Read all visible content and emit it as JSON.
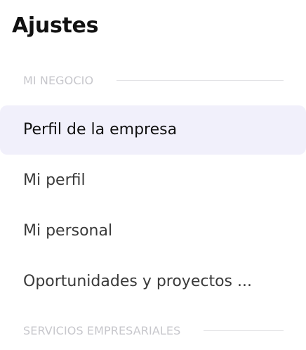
{
  "header": {
    "title": "Ajustes"
  },
  "sections": [
    {
      "label": "MI NEGOCIO",
      "items": [
        {
          "label": "Perfil de la empresa",
          "active": true
        },
        {
          "label": "Mi perfil",
          "active": false
        },
        {
          "label": "Mi personal",
          "active": false
        },
        {
          "label": "Oportunidades y proyectos ...",
          "active": false
        }
      ]
    },
    {
      "label": "SERVICIOS EMPRESARIALES",
      "items": []
    }
  ],
  "colors": {
    "active_background": "#f1f0fb",
    "section_label": "#c7c7cc",
    "item_text": "#3a3a3a",
    "title_text": "#111111"
  }
}
